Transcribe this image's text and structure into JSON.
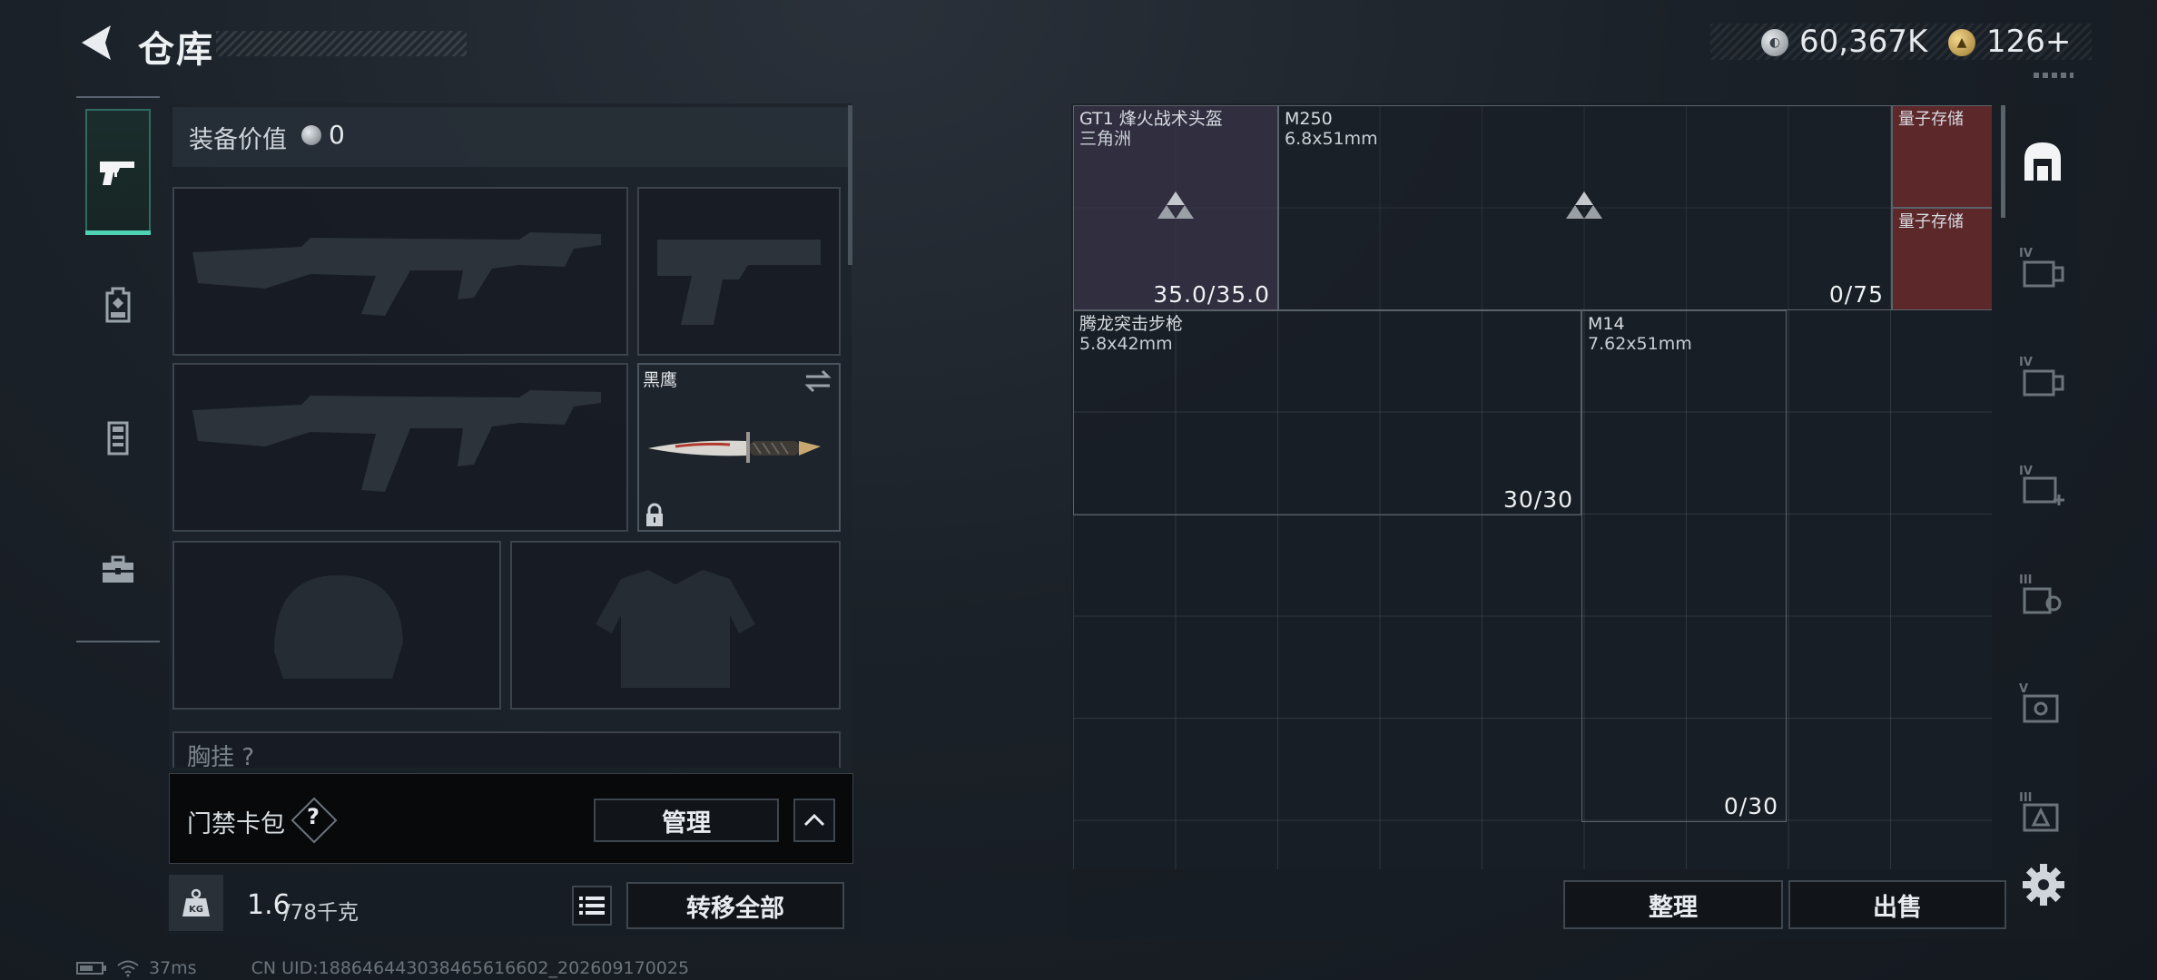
{
  "header": {
    "title": "仓库"
  },
  "currency": {
    "coins": "60,367K",
    "gold": "126+"
  },
  "equipment": {
    "value_label": "装备价值",
    "value": "0",
    "melee_name": "黑鹰",
    "chest_rig_label": "胸挂 ?"
  },
  "access_card": {
    "label": "门禁卡包",
    "help": "?",
    "manage_label": "管理"
  },
  "weight": {
    "current": "1.6",
    "max": "/78千克"
  },
  "transfer_label": "转移全部",
  "status": {
    "ping": "37ms",
    "uid": "CN UID:18864644303846561660​2_202609170025"
  },
  "storage": {
    "items": [
      {
        "name": "GT1 烽火战术头盔",
        "sub": "三角洲",
        "count": "35.0/35.0"
      },
      {
        "name": "M250",
        "sub": "6.8x51mm",
        "count": "0/75"
      },
      {
        "name": "量子存储",
        "sub": "",
        "count": ""
      },
      {
        "name": "量子存储",
        "sub": "",
        "count": ""
      },
      {
        "name": "腾龙突击步枪",
        "sub": "5.8x42mm",
        "count": "30/30"
      },
      {
        "name": "M14",
        "sub": "7.62x51mm",
        "count": "0/30"
      }
    ],
    "sort_label": "整理",
    "sell_label": "出售"
  },
  "categories": [
    "helmet-icon",
    "armor-iv-icon",
    "armor-iv-icon",
    "medkit-iv-icon",
    "rig-iii-icon",
    "pack-v-icon",
    "pack-iii-icon"
  ],
  "colors": {
    "accent": "#4fd3b4",
    "quantum": "#6a2a2c",
    "helmet_tint": "#3a3446"
  }
}
